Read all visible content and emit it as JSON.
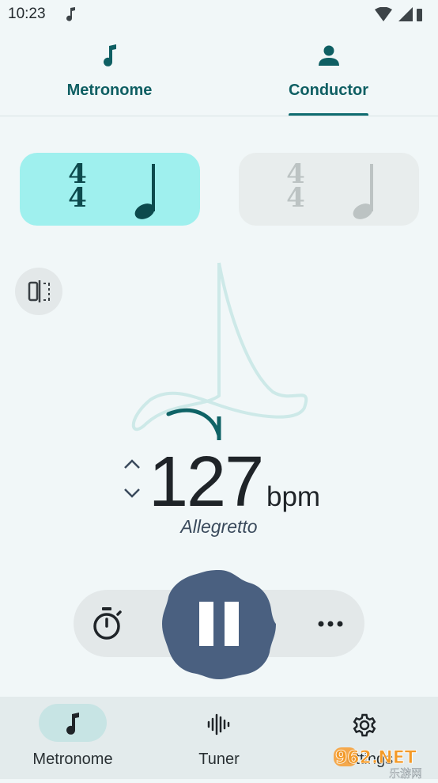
{
  "status_bar": {
    "time": "10:23"
  },
  "top_tabs": [
    {
      "label": "Metronome",
      "icon": "music-note-icon",
      "selected": false
    },
    {
      "label": "Conductor",
      "icon": "person-icon",
      "selected": true
    }
  ],
  "time_signatures": [
    {
      "numerator": "4",
      "denominator": "4",
      "note": "quarter-note-icon",
      "active": true
    },
    {
      "numerator": "4",
      "denominator": "4",
      "note": "quarter-note-icon",
      "active": false
    }
  ],
  "tempo": {
    "bpm": "127",
    "unit": "bpm",
    "marking": "Allegretto"
  },
  "colors": {
    "accent": "#0f6c70",
    "active_card": "#9ff0ee",
    "play_button": "#4a6080",
    "conductor_path": "#cde9e8",
    "beat_arc": "#0f6366"
  },
  "bottom_nav": [
    {
      "label": "Metronome",
      "icon": "music-note-icon",
      "selected": true
    },
    {
      "label": "Tuner",
      "icon": "waveform-icon",
      "selected": false
    },
    {
      "label": "Settings",
      "icon": "gear-icon",
      "selected": false
    }
  ],
  "watermark": {
    "text": "962.NET",
    "subtext": "乐游网"
  }
}
